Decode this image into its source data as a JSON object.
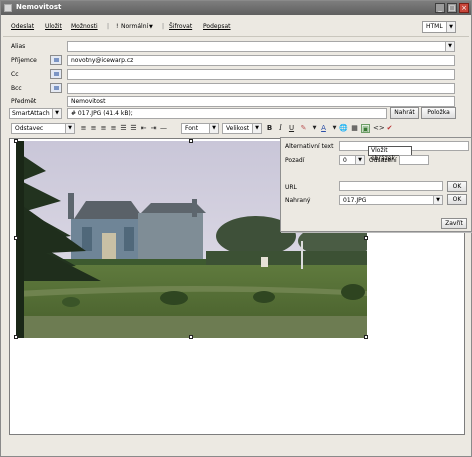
{
  "window": {
    "title": "Nemovitost"
  },
  "toolbar": {
    "send": "Odeslat",
    "save": "Uložit",
    "options": "Možnosti",
    "priority": "Normální",
    "spellcheck": "Šifrovat",
    "sign": "Podepsat",
    "format": "HTML"
  },
  "fields": {
    "alias_label": "Alias",
    "to_label": "Příjemce",
    "to_value": "novotny@icewarp.cz",
    "cc_label": "Cc",
    "bcc_label": "Bcc",
    "subject_label": "Předmět",
    "subject_value": "Nemovitost"
  },
  "attach": {
    "label": "SmartAttach",
    "value": "# 017.JPG (41.4 kB);",
    "browse_button": "Nahrát",
    "item_button": "Položka"
  },
  "format_bar": {
    "style": "Odstavec",
    "font": "Font",
    "size": "Velikost"
  },
  "image_dialog": {
    "alt_label": "Alternativní text",
    "position_label": "Pozadí",
    "position_value": "0",
    "spacing_label": "Odsazení",
    "url_label": "URL",
    "ok1": "OK",
    "uploaded_label": "Nahraný",
    "uploaded_value": "017.JPG",
    "ok2": "OK",
    "close_button": "Zavřít",
    "tooltip": "Vložit obrázek"
  }
}
